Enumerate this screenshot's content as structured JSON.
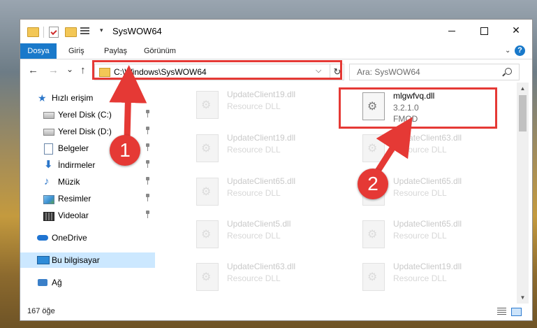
{
  "window": {
    "title": "SysWOW64",
    "minimize_glyph": "",
    "maximize_glyph": "",
    "close_glyph": "✕"
  },
  "ribbon": {
    "tabs": [
      {
        "label": "Dosya",
        "active": true
      },
      {
        "label": "Giriş"
      },
      {
        "label": "Paylaş"
      },
      {
        "label": "Görünüm"
      }
    ],
    "help_label": "?"
  },
  "nav": {
    "back_glyph": "←",
    "forward_glyph": "→",
    "recent_glyph": "⌄",
    "up_glyph": "↑",
    "address": "C:\\Windows\\SysWOW64",
    "address_dropdown_glyph": "⌵",
    "refresh_glyph": "↻",
    "search_placeholder": "Ara: SysWOW64"
  },
  "sidebar": {
    "items": [
      {
        "label": "Hızlı erişim",
        "icon": "star-icon"
      },
      {
        "label": "Yerel Disk (C:)",
        "icon": "drive-icon",
        "pinned": true
      },
      {
        "label": "Yerel Disk (D:)",
        "icon": "drive-icon",
        "pinned": true
      },
      {
        "label": "Belgeler",
        "icon": "documents-icon",
        "pinned": true
      },
      {
        "label": "İndirmeler",
        "icon": "download-icon",
        "pinned": true
      },
      {
        "label": "Müzik",
        "icon": "music-icon",
        "pinned": true
      },
      {
        "label": "Resimler",
        "icon": "pictures-icon",
        "pinned": true
      },
      {
        "label": "Videolar",
        "icon": "videos-icon",
        "pinned": true
      },
      {
        "label": "OneDrive",
        "icon": "onedrive-icon"
      },
      {
        "label": "Bu bilgisayar",
        "icon": "this-pc-icon",
        "selected": true
      },
      {
        "label": "Ağ",
        "icon": "network-icon"
      }
    ]
  },
  "files": {
    "faded": [
      {
        "name": "UpdateClient19.dll",
        "desc": "Resource DLL"
      },
      {
        "name": "UpdateClient19.dll",
        "desc": "Resource DLL"
      },
      {
        "name": "UpdateClient63.dll",
        "desc": "Resource DLL"
      },
      {
        "name": "UpdateClient65.dll",
        "desc": "Resource DLL"
      },
      {
        "name": "UpdateClient65.dll",
        "desc": "Resource DLL"
      },
      {
        "name": "UpdateClient5.dll",
        "desc": "Resource DLL"
      },
      {
        "name": "UpdateClient65.dll",
        "desc": "Resource DLL"
      },
      {
        "name": "UpdateClient63.dll",
        "desc": "Resource DLL"
      },
      {
        "name": "UpdateClient19.dll",
        "desc": "Resource DLL"
      }
    ],
    "highlighted": {
      "name": "mlgwfvq.dll",
      "version": "3.2.1.0",
      "company": "FMOD"
    }
  },
  "scrollbar": {
    "up_glyph": "▲",
    "down_glyph": "▼"
  },
  "status": {
    "item_count": "167 öğe"
  },
  "annotations": {
    "step1": "1",
    "step2": "2",
    "color": "#e53935"
  },
  "colors": {
    "accent": "#1979ca",
    "selection": "#cce8ff"
  }
}
